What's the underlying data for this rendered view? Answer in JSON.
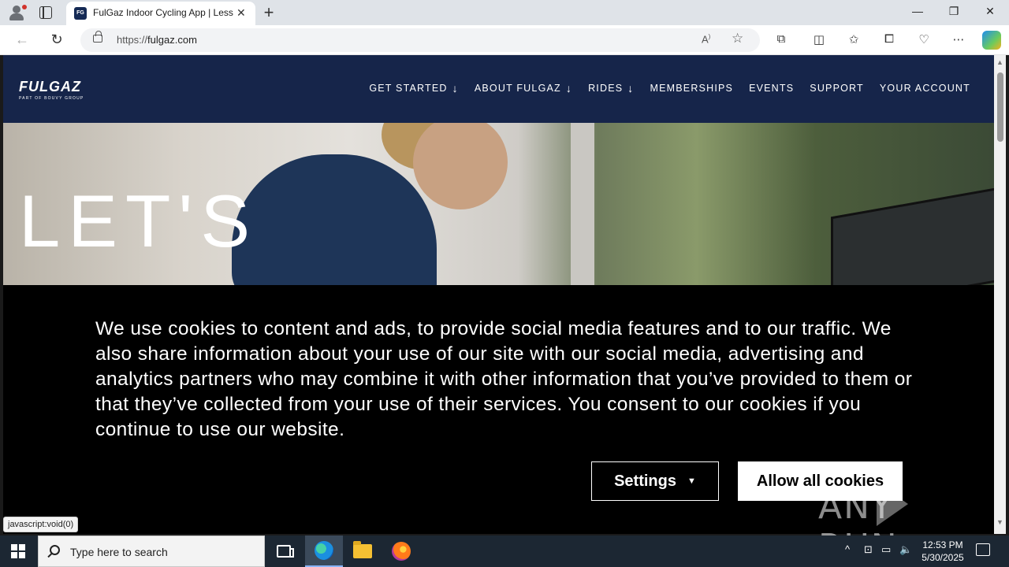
{
  "browser": {
    "tab_title": "FulGaz Indoor Cycling App | Less",
    "url_scheme": "https://",
    "url_host": "fulgaz.com",
    "new_tab_symbol": "+",
    "tab_close_symbol": "✕"
  },
  "site": {
    "logo_main": "FULGAZ",
    "logo_sub": "PART OF BOUVY GROUP",
    "menu": [
      {
        "label": "GET STARTED",
        "has_dropdown": true
      },
      {
        "label": "ABOUT FULGAZ",
        "has_dropdown": true
      },
      {
        "label": "RIDES",
        "has_dropdown": true
      },
      {
        "label": "MEMBERSHIPS",
        "has_dropdown": false
      },
      {
        "label": "EVENTS",
        "has_dropdown": false
      },
      {
        "label": "SUPPORT",
        "has_dropdown": false
      },
      {
        "label": "YOUR ACCOUNT",
        "has_dropdown": false
      }
    ],
    "dropdown_arrow": "↓",
    "hero_headline": "LET'S"
  },
  "cookie_banner": {
    "text": "We use cookies to content and ads, to provide social media features and to our traffic. We also share information about your use of our site with our social media, advertising and analytics partners who may combine it with other information that you’ve provided to them or that they’ve collected from your use of their services. You consent to our cookies if you continue to use our website.",
    "settings_label": "Settings",
    "settings_caret": "▼",
    "allow_label": "Allow all cookies"
  },
  "status_tooltip": "javascript:void(0)",
  "watermark_text": "ANY  RUN",
  "taskbar": {
    "search_placeholder": "Type here to search",
    "time": "12:53 PM",
    "date": "5/30/2025"
  },
  "colors": {
    "site_header": "#16254a",
    "cookie_bg": "#000000",
    "taskbar": "#1c2733"
  }
}
